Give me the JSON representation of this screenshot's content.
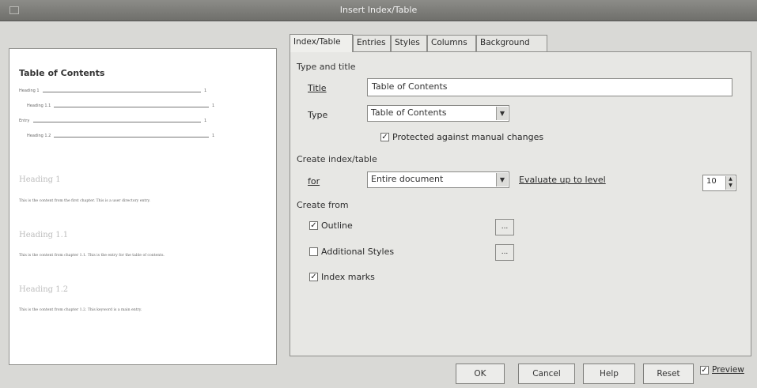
{
  "window": {
    "title": "Insert Index/Table"
  },
  "preview": {
    "heading": "Table of Contents",
    "toc_entries": [
      {
        "label": "Heading 1",
        "page": "1"
      },
      {
        "label": "Heading 1.1",
        "page": "1"
      },
      {
        "label": "Entry",
        "page": "1"
      },
      {
        "label": "Heading 1.2",
        "page": "1"
      }
    ],
    "sections": [
      {
        "heading": "Heading 1",
        "body": "This is the content from the first chapter. This is a user directory entry."
      },
      {
        "heading": "Heading 1.1",
        "body": "This is the content from chapter 1.1. This is the entry for the table of contents."
      },
      {
        "heading": "Heading 1.2",
        "body": "This is the content from chapter 1.2. This keyword is a main entry."
      }
    ]
  },
  "tabs": [
    "Index/Table",
    "Entries",
    "Styles",
    "Columns",
    "Background"
  ],
  "type_and_title": {
    "section_label": "Type and title",
    "title_label": "Title",
    "title_value": "Table of Contents",
    "type_label": "Type",
    "type_value": "Table of Contents",
    "protected_label": "Protected against manual changes",
    "protected_checked": true
  },
  "create_index": {
    "section_label": "Create index/table",
    "for_label": "for",
    "for_value": "Entire document",
    "evaluate_label": "Evaluate up to level",
    "level_value": "10"
  },
  "create_from": {
    "section_label": "Create from",
    "outline_label": "Outline",
    "outline_checked": true,
    "outline_button": "...",
    "additional_styles_label": "Additional Styles",
    "additional_styles_checked": false,
    "additional_button": "...",
    "index_marks_label": "Index marks",
    "index_marks_checked": true
  },
  "footer": {
    "ok": "OK",
    "cancel": "Cancel",
    "help": "Help",
    "reset": "Reset",
    "preview_label": "Preview",
    "preview_checked": true
  },
  "check_glyph": "✓"
}
